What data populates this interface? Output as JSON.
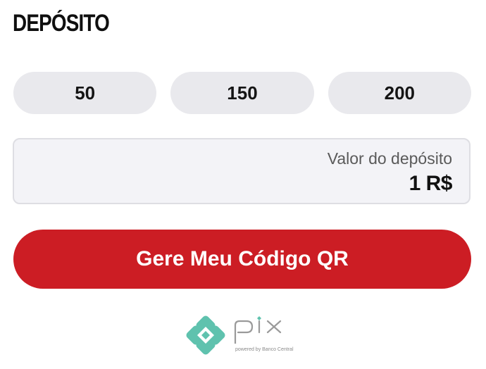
{
  "deposit": {
    "title": "DEPÓSITO",
    "presets": [
      {
        "label": "50"
      },
      {
        "label": "150"
      },
      {
        "label": "200"
      }
    ],
    "amount_label": "Valor do depósito",
    "amount_value": "1 R$",
    "generate_button": "Gere Meu Código QR"
  },
  "payment_logo": {
    "icon": "pix-logo-icon",
    "brand_word": "pix",
    "tagline": "powered by Banco Central"
  },
  "colors": {
    "accent": "#cc1d24",
    "preset_bg": "#e9e9ed",
    "input_bg": "#f3f3f7",
    "pix_teal": "#5fc2ae",
    "pix_gray": "#9a9a9a"
  }
}
